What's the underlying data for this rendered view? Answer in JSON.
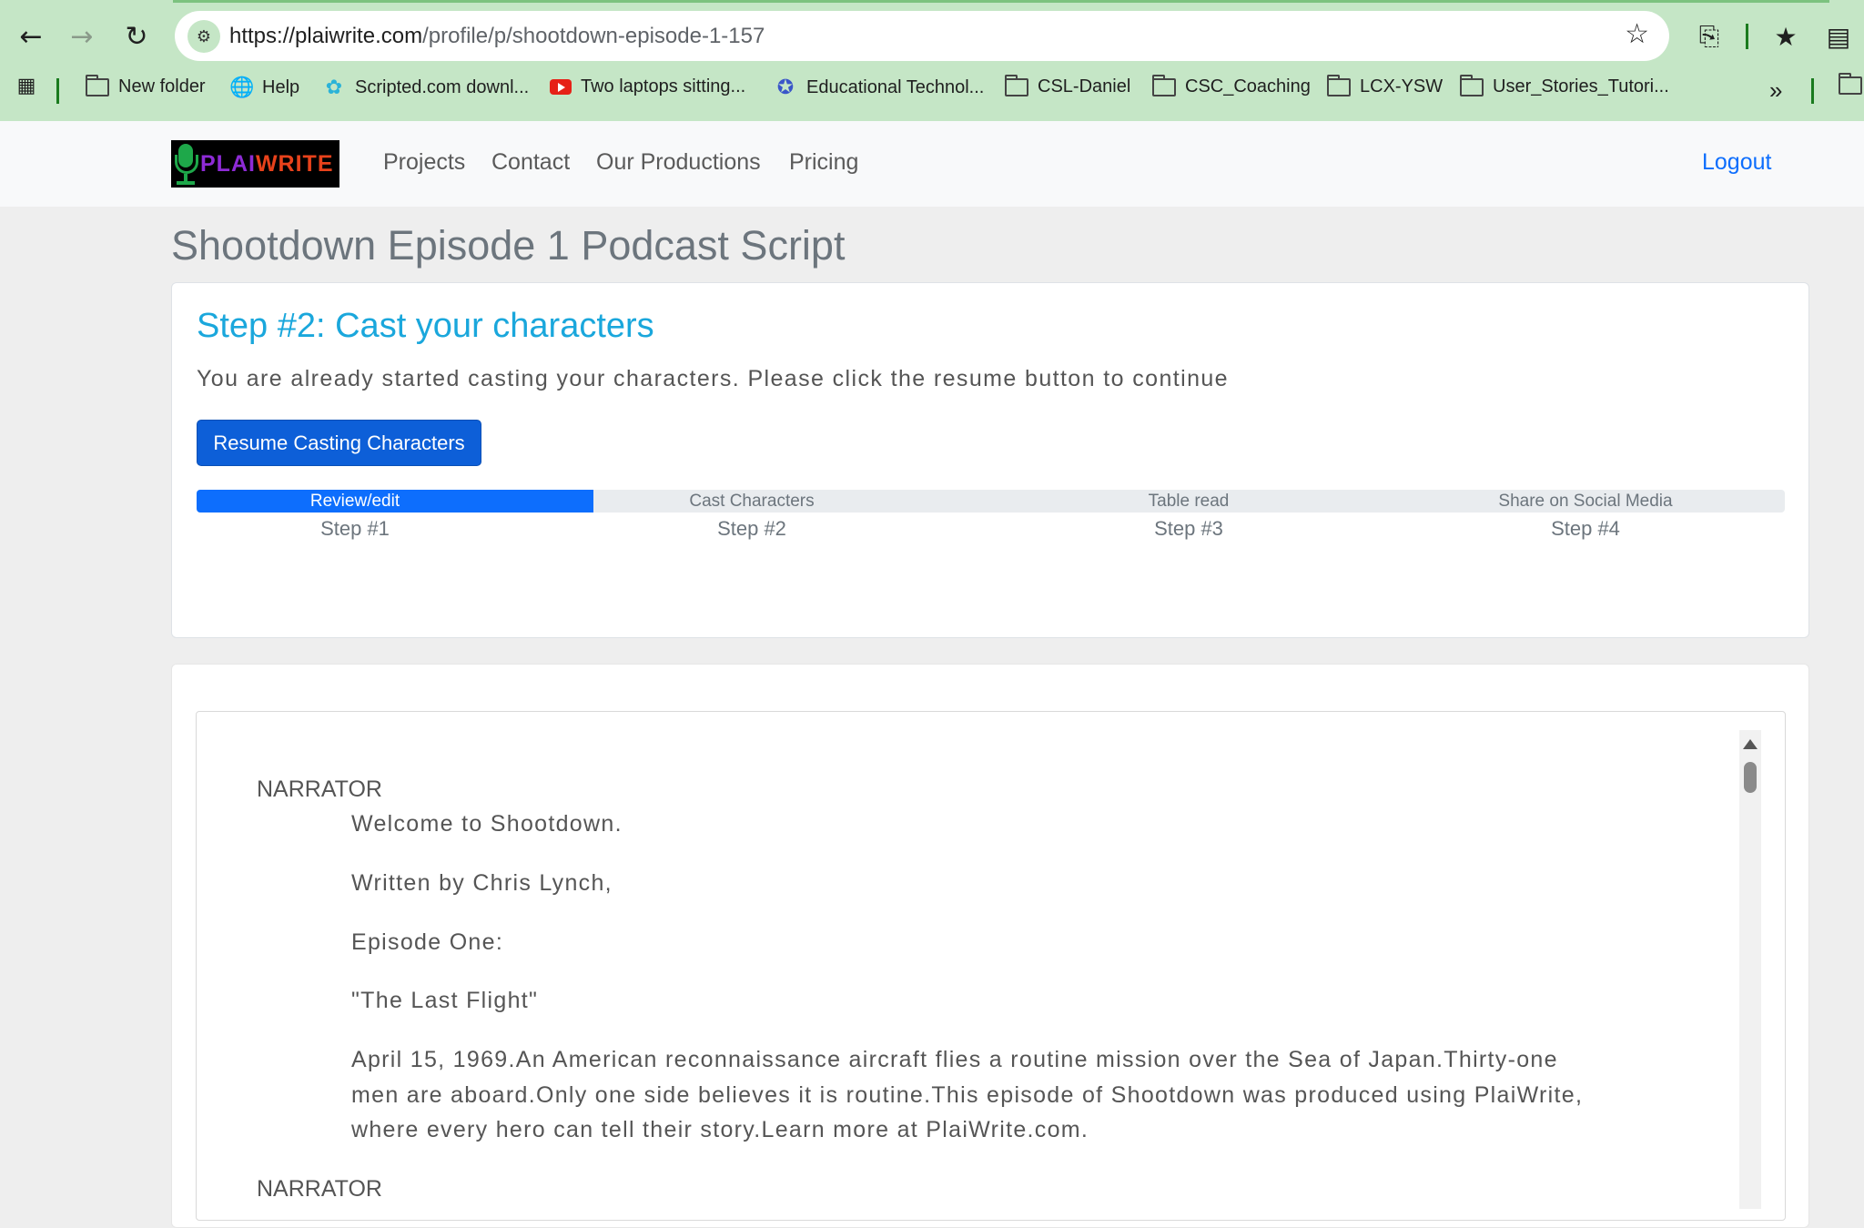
{
  "browser": {
    "url_host": "https://plaiwrite.com",
    "url_path": "/profile/p/shootdown-episode-1-157",
    "bookmarks": [
      {
        "label": "New folder",
        "icon": "folder-icon"
      },
      {
        "label": "Help",
        "icon": "globe-icon"
      },
      {
        "label": "Scripted.com downl...",
        "icon": "scripted-icon"
      },
      {
        "label": "Two laptops sitting...",
        "icon": "youtube-icon"
      },
      {
        "label": "Educational Technol...",
        "icon": "compass-icon"
      },
      {
        "label": "CSL-Daniel",
        "icon": "folder-icon"
      },
      {
        "label": "CSC_Coaching",
        "icon": "folder-icon"
      },
      {
        "label": "LCX-YSW",
        "icon": "folder-icon"
      },
      {
        "label": "User_Stories_Tutori...",
        "icon": "folder-icon"
      }
    ]
  },
  "site": {
    "logo_part1": "PLAI",
    "logo_part2": "WRITE",
    "nav": [
      "Projects",
      "Contact",
      "Our Productions",
      "Pricing"
    ],
    "logout": "Logout"
  },
  "page": {
    "title": "Shootdown Episode 1 Podcast Script"
  },
  "step_card": {
    "heading": "Step #2: Cast your characters",
    "description": "You are already started casting your characters. Please click the resume button to continue",
    "resume_button": "Resume Casting Characters",
    "progress_fraction": 0.25,
    "steps": [
      {
        "label": "Review/edit",
        "number": "Step #1"
      },
      {
        "label": "Cast Characters",
        "number": "Step #2"
      },
      {
        "label": "Table read",
        "number": "Step #3"
      },
      {
        "label": "Share on Social Media",
        "number": "Step #4"
      }
    ]
  },
  "script": {
    "blocks": [
      {
        "speaker": "NARRATOR",
        "lines": [
          "Welcome to Shootdown.",
          "Written by Chris Lynch,",
          "Episode One:",
          "\"The Last Flight\"",
          "April 15, 1969.An American reconnaissance aircraft flies a routine mission over the Sea of Japan.Thirty-one men are aboard.Only one side believes it is routine.This episode of Shootdown was produced using PlaiWrite, where every hero can tell their story.Learn more at PlaiWrite.com."
        ]
      },
      {
        "speaker": "NARRATOR",
        "lines": []
      }
    ]
  }
}
